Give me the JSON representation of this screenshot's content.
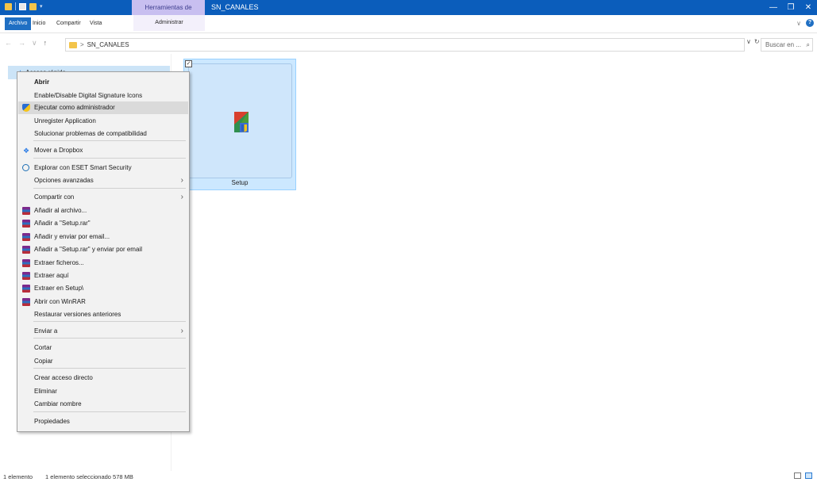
{
  "titlebar": {
    "context_tab": "Herramientas de aplicación",
    "title": "SN_CANALES",
    "controls": [
      "—",
      "❐",
      "✕"
    ]
  },
  "ribbon": {
    "tabs": [
      "Archivo",
      "Inicio",
      "Compartir",
      "Vista"
    ],
    "context_tab": "Administrar",
    "collapse": "∨",
    "help": "?"
  },
  "address": {
    "back": "←",
    "forward": "→",
    "recent": "∨",
    "up": "↑",
    "crumb_sep": ">",
    "path": "SN_CANALES",
    "dropdown": "∨",
    "refresh": "↻",
    "search_placeholder": "Buscar en ..."
  },
  "nav": {
    "quick_access": "Acceso rápido"
  },
  "file": {
    "name": "Setup",
    "checked": "✓"
  },
  "context_menu": {
    "items": [
      {
        "label": "Abrir",
        "bold": true
      },
      {
        "label": "Enable/Disable Digital Signature Icons"
      },
      {
        "label": "Ejecutar como administrador",
        "icon": "shield-icon",
        "highlighted": true
      },
      {
        "label": "Unregister Application"
      },
      {
        "label": "Solucionar problemas de compatibilidad"
      },
      {
        "label": "Mover a Dropbox",
        "icon": "dropbox-icon"
      },
      {
        "label": "Explorar con ESET Smart Security",
        "icon": "eset-icon"
      },
      {
        "label": "Opciones avanzadas",
        "submenu": true
      },
      {
        "label": "Compartir con",
        "submenu": true
      },
      {
        "label": "Añadir al archivo...",
        "icon": "winrar-icon"
      },
      {
        "label": "Añadir a \"Setup.rar\"",
        "icon": "winrar-icon"
      },
      {
        "label": "Añadir y enviar por email...",
        "icon": "winrar-icon"
      },
      {
        "label": "Añadir a \"Setup.rar\" y enviar por email",
        "icon": "winrar-icon"
      },
      {
        "label": "Extraer ficheros...",
        "icon": "winrar-icon"
      },
      {
        "label": "Extraer aquí",
        "icon": "winrar-icon"
      },
      {
        "label": "Extraer en Setup\\",
        "icon": "winrar-icon"
      },
      {
        "label": "Abrir con WinRAR",
        "icon": "winrar-icon"
      },
      {
        "label": "Restaurar versiones anteriores"
      },
      {
        "label": "Enviar a",
        "submenu": true
      },
      {
        "label": "Cortar"
      },
      {
        "label": "Copiar"
      },
      {
        "label": "Crear acceso directo"
      },
      {
        "label": "Eliminar"
      },
      {
        "label": "Cambiar nombre"
      },
      {
        "label": "Propiedades"
      }
    ],
    "submenu_arrow": "›"
  },
  "status": {
    "count": "1 elemento",
    "selection": "1 elemento seleccionado  578 MB"
  },
  "colors": {
    "titlebar": "#0b5dbb",
    "selection": "#cce8ff",
    "menu_bg": "#f2f2f2"
  }
}
